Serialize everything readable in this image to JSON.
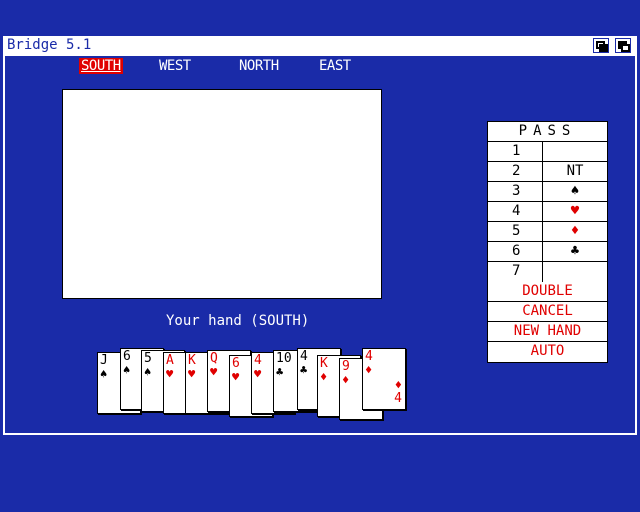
{
  "window": {
    "title": "Bridge 5.1"
  },
  "seats": [
    {
      "label": "SOUTH",
      "active": true
    },
    {
      "label": "WEST",
      "active": false
    },
    {
      "label": "NORTH",
      "active": false
    },
    {
      "label": "EAST",
      "active": false
    }
  ],
  "hand_label": "Your hand (SOUTH)",
  "hand": [
    {
      "rank": "J",
      "suit": "♠",
      "color": "black"
    },
    {
      "rank": "6",
      "suit": "♠",
      "color": "black"
    },
    {
      "rank": "5",
      "suit": "♠",
      "color": "black"
    },
    {
      "rank": "A",
      "suit": "♥",
      "color": "red"
    },
    {
      "rank": "K",
      "suit": "♥",
      "color": "red"
    },
    {
      "rank": "Q",
      "suit": "♥",
      "color": "red"
    },
    {
      "rank": "6",
      "suit": "♥",
      "color": "red"
    },
    {
      "rank": "4",
      "suit": "♥",
      "color": "red"
    },
    {
      "rank": "10",
      "suit": "♣",
      "color": "black"
    },
    {
      "rank": "4",
      "suit": "♣",
      "color": "black"
    },
    {
      "rank": "K",
      "suit": "♦",
      "color": "red"
    },
    {
      "rank": "9",
      "suit": "♦",
      "color": "red"
    },
    {
      "rank": "4",
      "suit": "♦",
      "color": "red"
    }
  ],
  "bidding": {
    "pass_label": "PASS",
    "levels": [
      "1",
      "2",
      "3",
      "4",
      "5",
      "6",
      "7"
    ],
    "strains": [
      "",
      "NT",
      "♠",
      "♥",
      "♦",
      "♣",
      ""
    ],
    "strain_colors": [
      "black",
      "black",
      "black",
      "red",
      "red",
      "black",
      "black"
    ],
    "double_label": "DOUBLE",
    "cancel_label": "CANCEL",
    "new_hand_label": "NEW HAND",
    "auto_label": "AUTO"
  },
  "colors": {
    "background": "#1a2ba8",
    "accent": "#e00000"
  }
}
